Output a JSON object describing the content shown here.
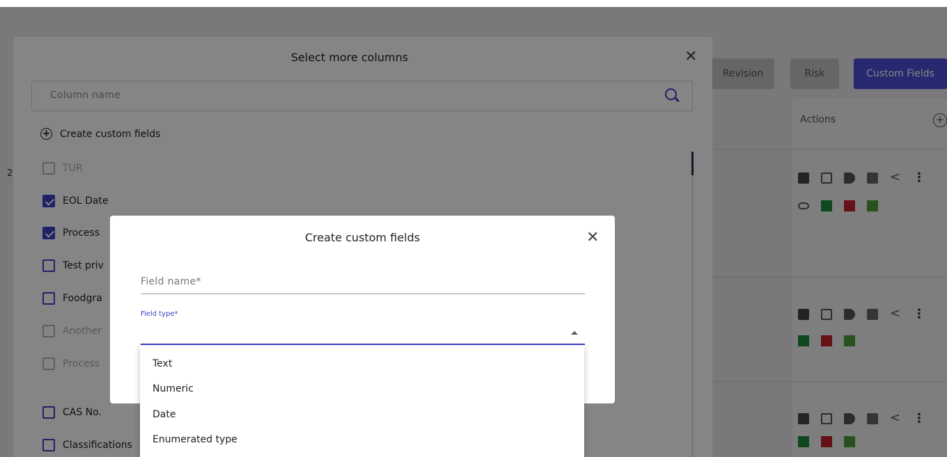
{
  "background": {
    "tabs": [
      "Revision",
      "Risk",
      "Custom Fields"
    ],
    "actions_label": "Actions",
    "left_fragment": "2"
  },
  "dialog_columns": {
    "title": "Select more columns",
    "search_placeholder": "Column name",
    "create_label": "Create custom fields",
    "items": [
      {
        "label": "TUR",
        "checked": false,
        "disabled": true
      },
      {
        "label": "EOL Date",
        "checked": true,
        "disabled": false
      },
      {
        "label": "Process",
        "checked": true,
        "disabled": false
      },
      {
        "label": "Test priv",
        "checked": false,
        "disabled": false
      },
      {
        "label": "Foodgra",
        "checked": false,
        "disabled": false
      },
      {
        "label": "Another",
        "checked": false,
        "disabled": true
      },
      {
        "label": "Process",
        "checked": false,
        "disabled": true
      },
      {
        "label": "CAS No.",
        "checked": false,
        "disabled": false
      },
      {
        "label": "Classifications",
        "checked": false,
        "disabled": false
      }
    ]
  },
  "dialog_custom": {
    "title": "Create custom fields",
    "field_name_placeholder": "Field name*",
    "field_type_label": "Field type*",
    "options": [
      "Text",
      "Numeric",
      "Date",
      "Enumerated type"
    ]
  },
  "colors": {
    "accent": "#3c40c6",
    "tab_active": "#4a4fd6"
  }
}
